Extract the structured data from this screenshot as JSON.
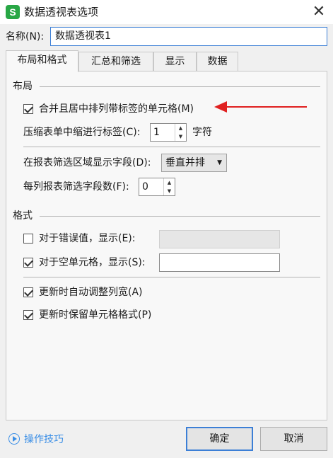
{
  "window": {
    "app_icon": "S",
    "title": "数据透视表选项",
    "close": "✕"
  },
  "name_field": {
    "label": "名称(N):",
    "value": "数据透视表1"
  },
  "tabs": [
    {
      "label": "布局和格式",
      "active": true
    },
    {
      "label": "汇总和筛选"
    },
    {
      "label": "显示"
    },
    {
      "label": "数据"
    }
  ],
  "layout_section": {
    "title": "布局",
    "merge_center": {
      "label": "合并且居中排列带标签的单元格(M)",
      "checked": true
    },
    "indent": {
      "label": "压缩表单中缩进行标签(C):",
      "value": "1",
      "unit": "字符"
    },
    "filter_order": {
      "label": "在报表筛选区域显示字段(D):",
      "value": "垂直并排"
    },
    "filter_count": {
      "label": "每列报表筛选字段数(F):",
      "value": "0"
    }
  },
  "format_section": {
    "title": "格式",
    "error_values": {
      "label": "对于错误值，显示(E):",
      "checked": false,
      "value": ""
    },
    "empty_cells": {
      "label": "对于空单元格，显示(S):",
      "checked": true,
      "value": ""
    },
    "autofit": {
      "label": "更新时自动调整列宽(A)",
      "checked": true
    },
    "preserve_format": {
      "label": "更新时保留单元格格式(P)",
      "checked": true
    }
  },
  "footer": {
    "tips": "操作技巧",
    "ok": "确定",
    "cancel": "取消"
  },
  "colors": {
    "accent": "#3c7fd6",
    "app_icon": "#28a745",
    "annotation_arrow": "#e02020",
    "tips_link": "#3a8ee6"
  },
  "icons": {
    "app": "wps-spreadsheet-icon",
    "close": "close-icon",
    "tips": "play-circle-icon",
    "spin_up": "triangle-up-icon",
    "spin_down": "triangle-down-icon",
    "dropdown": "triangle-down-icon"
  }
}
